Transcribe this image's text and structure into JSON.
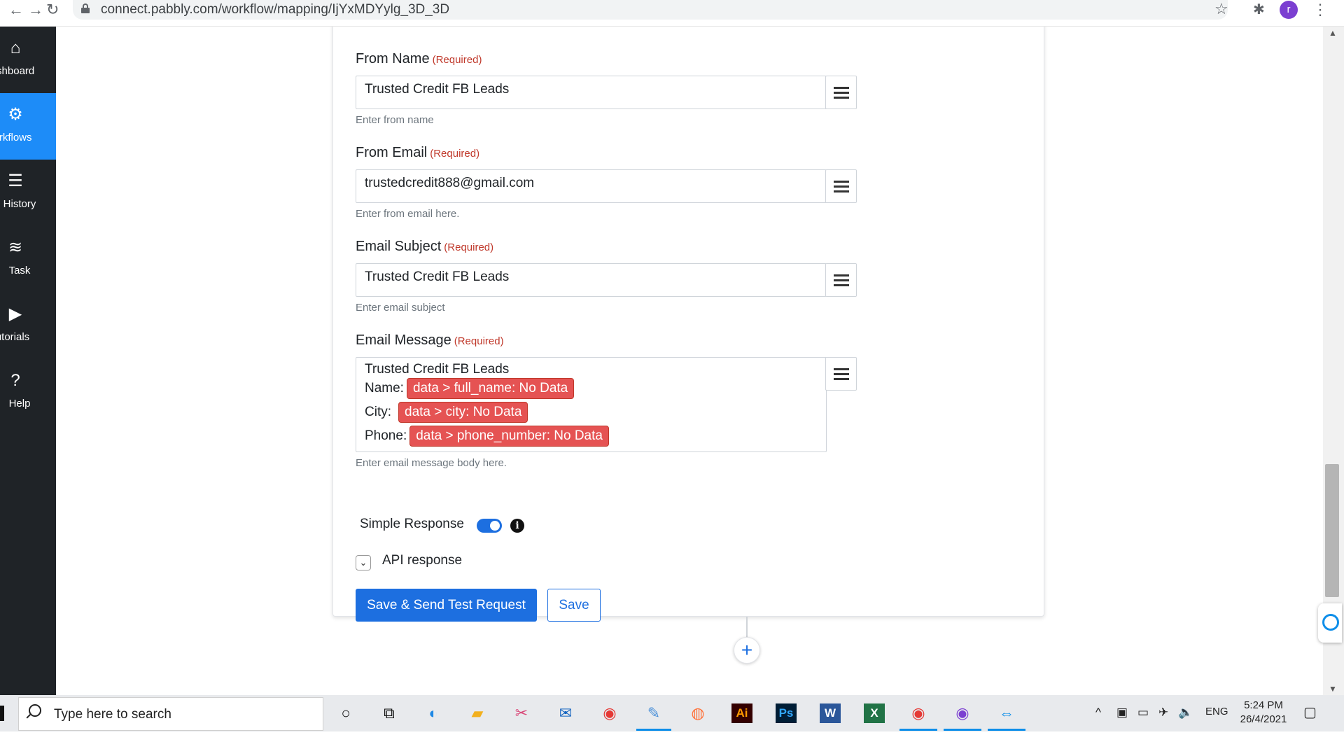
{
  "browser": {
    "url": "connect.pabbly.com/workflow/mapping/IjYxMDYylg_3D_3D",
    "profile_initial": "r",
    "back_glyph": "←",
    "forward_glyph": "→",
    "reload_glyph": "↻",
    "star_glyph": "☆",
    "puzzle_glyph": "✱",
    "menu_glyph": "⋮"
  },
  "sidebar": {
    "items": [
      {
        "label": "ashboard",
        "icon": "home-icon",
        "glyph": "⌂"
      },
      {
        "label": "orkflows",
        "icon": "workflow-icon",
        "glyph": "⚙"
      },
      {
        "label": "History",
        "icon": "list-icon",
        "glyph": "☰"
      },
      {
        "label": "Task",
        "icon": "database-icon",
        "glyph": "≋"
      },
      {
        "label": "utorials",
        "icon": "play-icon",
        "glyph": "▶"
      },
      {
        "label": "Help",
        "icon": "help-icon",
        "glyph": "?"
      }
    ]
  },
  "form": {
    "from_name": {
      "label": "From Name",
      "required": "(Required)",
      "value": "Trusted Credit FB Leads",
      "hint": "Enter from name"
    },
    "from_email": {
      "label": "From Email",
      "required": "(Required)",
      "value": "trustedcredit888@gmail.com",
      "hint": "Enter from email here."
    },
    "email_subject": {
      "label": "Email Subject",
      "required": "(Required)",
      "value": "Trusted Credit FB Leads",
      "hint": "Enter email subject"
    },
    "email_message": {
      "label": "Email Message",
      "required": "(Required)",
      "title_line": "Trusted Credit FB Leads",
      "lines": [
        {
          "prefix": "Name:",
          "token": "data > full_name: No Data"
        },
        {
          "prefix": "City:",
          "token": "data > city: No Data"
        },
        {
          "prefix": "Phone:",
          "token": "data > phone_number: No Data"
        }
      ],
      "hint": "Enter email message body here."
    },
    "simple_response": {
      "label": "Simple Response",
      "enabled": true,
      "info_glyph": "i"
    },
    "api_response": {
      "label": "API response",
      "chevron_glyph": "⌄"
    },
    "buttons": {
      "save_send": "Save & Send Test Request",
      "save": "Save"
    },
    "add_step_glyph": "+"
  },
  "taskbar": {
    "search_placeholder": "Type here to search",
    "language": "ENG",
    "time": "5:24 PM",
    "date": "26/4/2021",
    "apps": [
      {
        "name": "cortana-icon",
        "glyph": "○",
        "color": "#111111"
      },
      {
        "name": "task-view-icon",
        "glyph": "⧉",
        "color": "#111111"
      },
      {
        "name": "edge-icon",
        "glyph": "◐",
        "color": "#1e88e5"
      },
      {
        "name": "file-explorer-icon",
        "glyph": "▰",
        "color": "#f2b01e"
      },
      {
        "name": "snip-tool-icon",
        "glyph": "✂",
        "color": "#d94a7a"
      },
      {
        "name": "mail-icon",
        "glyph": "✉",
        "color": "#1565c0"
      },
      {
        "name": "chrome-icon",
        "glyph": "◉",
        "color": "#e53935"
      },
      {
        "name": "paint-icon",
        "glyph": "✎",
        "color": "#4a90d9"
      },
      {
        "name": "firefox-icon",
        "glyph": "◍",
        "color": "#ff7139"
      },
      {
        "name": "illustrator-icon",
        "glyph": "Ai",
        "color": "#ff9a00"
      },
      {
        "name": "photoshop-icon",
        "glyph": "Ps",
        "color": "#31a8ff"
      },
      {
        "name": "word-icon",
        "glyph": "W",
        "color": "#2b579a"
      },
      {
        "name": "excel-icon",
        "glyph": "X",
        "color": "#217346"
      },
      {
        "name": "chrome-profile-s-icon",
        "glyph": "◉",
        "color": "#e53935"
      },
      {
        "name": "chrome-profile-r-icon",
        "glyph": "◉",
        "color": "#7b3fd1"
      },
      {
        "name": "teamviewer-icon",
        "glyph": "⇔",
        "color": "#0e8ee9"
      }
    ],
    "tray": {
      "chevron": "^",
      "meet": "▣",
      "battery": "▭",
      "network": "✈",
      "volume": "🔈",
      "notifications": "▢"
    }
  },
  "colors": {
    "accent": "#1d6fe0",
    "sidebar_bg": "#1f2327",
    "sidebar_active": "#1d8cf8",
    "token_red": "#e55353",
    "required_red": "#c0392b"
  }
}
